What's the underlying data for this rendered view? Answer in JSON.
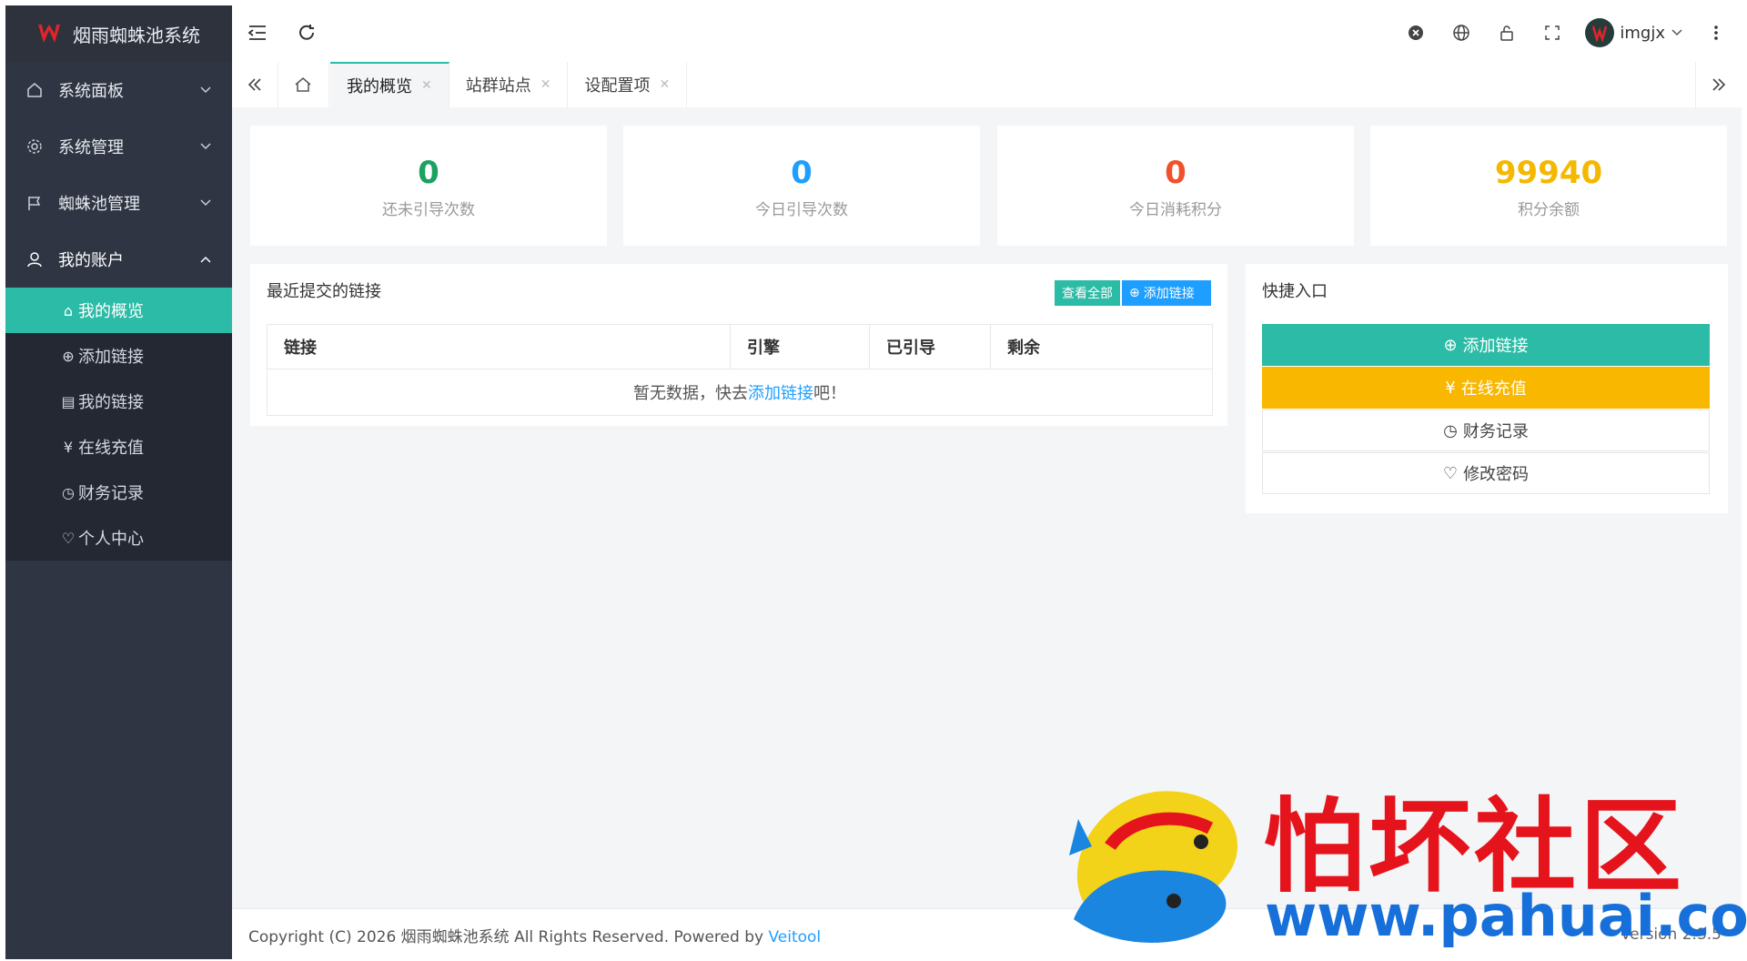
{
  "app": {
    "title": "烟雨蜘蛛池系统",
    "accent": "#2bbba6"
  },
  "sidebar": {
    "menus": [
      {
        "label": "系统面板",
        "icon": "home-icon",
        "expanded": false
      },
      {
        "label": "系统管理",
        "icon": "gear-icon",
        "expanded": false
      },
      {
        "label": "蜘蛛池管理",
        "icon": "flag-icon",
        "expanded": false
      },
      {
        "label": "我的账户",
        "icon": "user-icon",
        "expanded": true
      }
    ],
    "submenu": [
      {
        "label": "我的概览",
        "icon": "home-icon",
        "active": true
      },
      {
        "label": "添加链接",
        "icon": "plus-circle-icon"
      },
      {
        "label": "我的链接",
        "icon": "document-icon"
      },
      {
        "label": "在线充值",
        "icon": "yen-icon"
      },
      {
        "label": "财务记录",
        "icon": "clock-icon"
      },
      {
        "label": "个人中心",
        "icon": "shield-check-icon"
      }
    ]
  },
  "topbar": {
    "username": "imgjx"
  },
  "tabs": [
    {
      "label": "我的概览",
      "active": true
    },
    {
      "label": "站群站点"
    },
    {
      "label": "设配置项"
    }
  ],
  "stats": [
    {
      "value": "0",
      "label": "还未引导次数",
      "color": "#1aa260"
    },
    {
      "value": "0",
      "label": "今日引导次数",
      "color": "#1e9fff"
    },
    {
      "value": "0",
      "label": "今日消耗积分",
      "color": "#f0502a"
    },
    {
      "value": "99940",
      "label": "积分余额",
      "color": "#f5b800"
    }
  ],
  "recent": {
    "title": "最近提交的链接",
    "view_all": "查看全部",
    "add_link": "添加链接",
    "columns": [
      "链接",
      "引擎",
      "已引导",
      "剩余"
    ],
    "empty_prefix": "暂无数据，快去",
    "empty_link": "添加链接",
    "empty_suffix": "吧！"
  },
  "quick": {
    "title": "快捷入口",
    "items": [
      {
        "label": "添加链接"
      },
      {
        "label": "在线充值"
      },
      {
        "label": "财务记录"
      },
      {
        "label": "修改密码"
      }
    ]
  },
  "footer": {
    "copyright": "Copyright (C) 2026 烟雨蜘蛛池系统 All Rights Reserved. Powered by",
    "powered_by": "Veitool",
    "version": "Version 2.3.5"
  },
  "watermark": {
    "text": "怕坏社区",
    "url": "www.pahuai.com"
  }
}
